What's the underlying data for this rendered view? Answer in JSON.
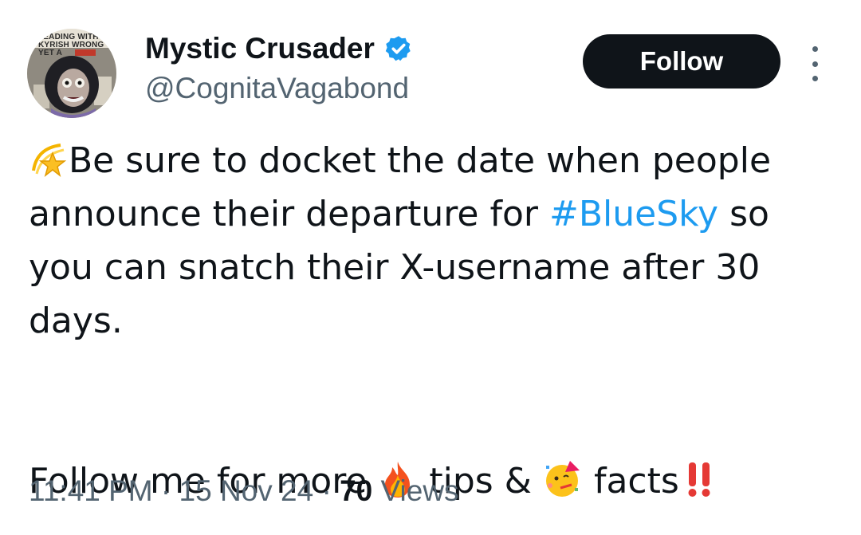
{
  "author": {
    "display_name": "Mystic Crusader",
    "handle": "@CognitaVagabond",
    "avatar_caption_line1": "LEADING WITH IN",
    "avatar_caption_line2": "KYRISH WRONG YET A",
    "verified_color": "#1d9bf0"
  },
  "actions": {
    "follow_label": "Follow",
    "more_icon": "more-vertical-icon"
  },
  "tweet": {
    "line1_emoji": "dizzy-star-emoji",
    "line1_text": "Be sure to docket the date when people announce their departure for ",
    "hashtag": "#BlueSky",
    "line1_text_after": " so you can snatch their X-username after 30 days.",
    "line2_text_a": "Follow me for more ",
    "line2_emoji1": "fire-emoji",
    "line2_text_b": " tips & ",
    "line2_emoji2": "partying-face-emoji",
    "line2_text_c": " facts",
    "line2_emoji3": "double-exclamation-emoji"
  },
  "meta": {
    "time": "11:41 PM",
    "sep1": " · ",
    "date": "15 Nov 24",
    "sep2": " · ",
    "views_count": "70",
    "views_label": " Views"
  },
  "colors": {
    "text": "#0f1419",
    "secondary": "#536471",
    "link": "#1d9bf0",
    "button_bg": "#0f1419"
  }
}
